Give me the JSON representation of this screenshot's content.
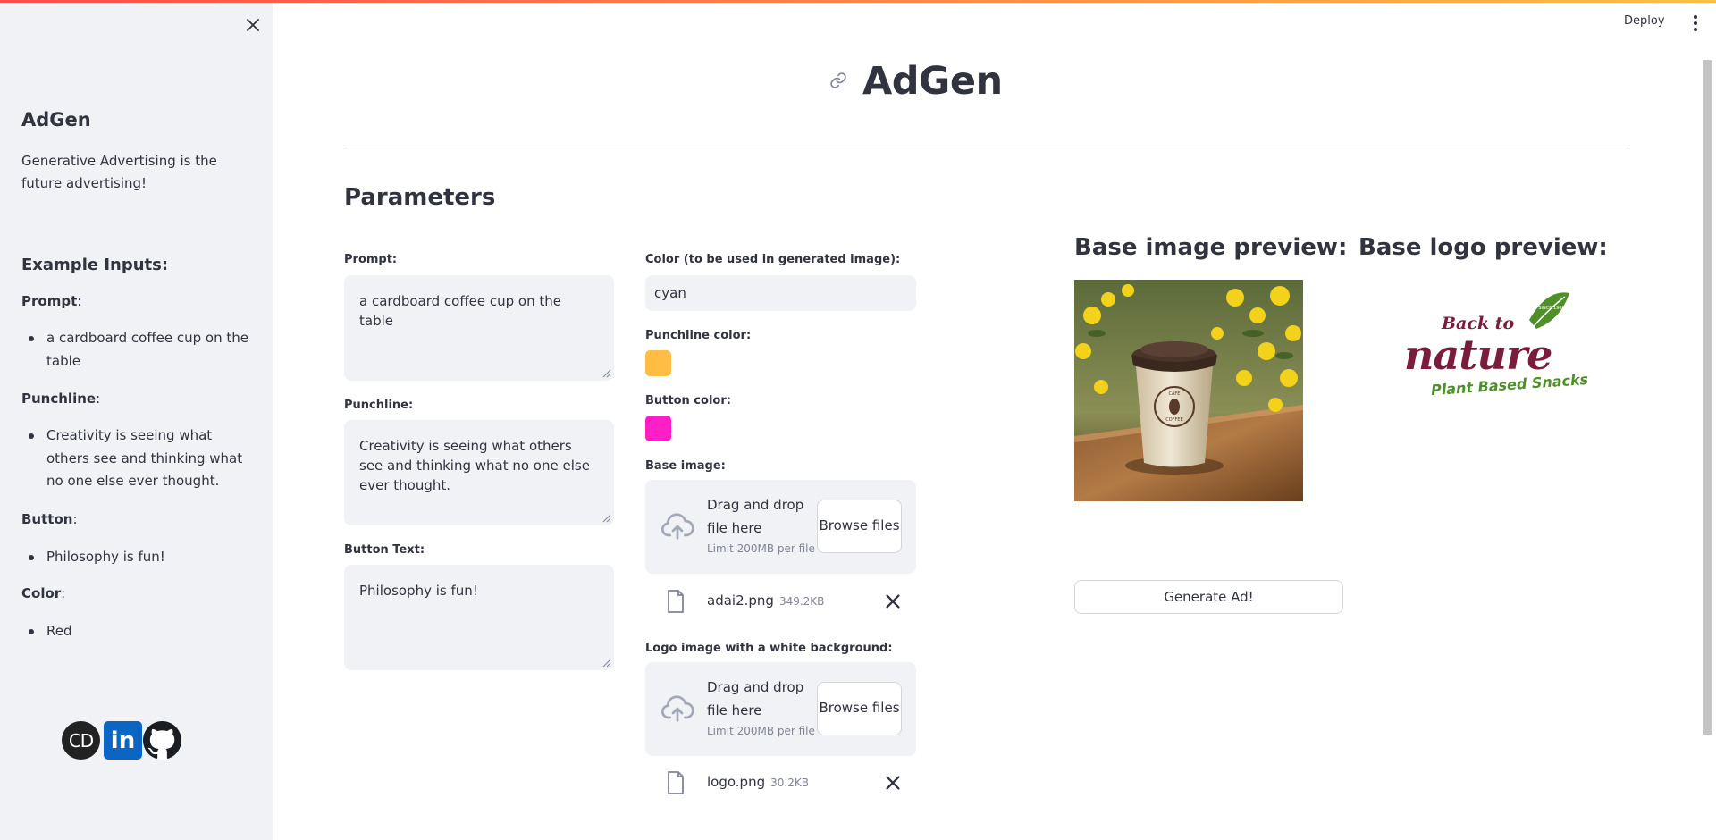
{
  "header": {
    "deploy_label": "Deploy"
  },
  "sidebar": {
    "title": "AdGen",
    "description": "Generative Advertising is the future advertising!",
    "examples_heading": "Example Inputs:",
    "prompt_label": "Prompt",
    "prompt_example": "a cardboard coffee cup on the table",
    "punchline_label": "Punchline",
    "punchline_example": "Creativity is seeing what others see and thinking what no one else ever thought.",
    "button_label": "Button",
    "button_example": "Philosophy is fun!",
    "color_label": "Color",
    "color_example": "Red",
    "social": {
      "cd": "CD",
      "linkedin": "in"
    }
  },
  "main": {
    "title": "AdGen",
    "section_title": "Parameters",
    "prompt": {
      "label": "Prompt:",
      "value": "a cardboard coffee cup on the table"
    },
    "punchline": {
      "label": "Punchline:",
      "value": "Creativity is seeing what others see and thinking what no one else ever thought."
    },
    "button_text": {
      "label": "Button Text:",
      "value": "Philosophy is fun!"
    },
    "color": {
      "label": "Color (to be used in generated image):",
      "value": "cyan"
    },
    "punchline_color": {
      "label": "Punchline color:",
      "value": "#ffbd45"
    },
    "button_color": {
      "label": "Button color:",
      "value": "#ff1fc7"
    },
    "base_image": {
      "label": "Base image:",
      "drop_text": "Drag and drop file here",
      "limit": "Limit 200MB per file",
      "browse": "Browse files",
      "file_name": "adai2.png",
      "file_size": "349.2KB"
    },
    "logo_image": {
      "label": "Logo image with a white background:",
      "drop_text": "Drag and drop file here",
      "limit": "Limit 200MB per file",
      "browse": "Browse files",
      "file_name": "logo.png",
      "file_size": "30.2KB"
    },
    "base_preview_title": "Base image preview:",
    "logo_preview_title": "Base logo preview:",
    "logo_text": {
      "line1": "Back to",
      "line2": "nature",
      "line3": "Plant Based Snacks",
      "badge": "SINCE 1960"
    },
    "cup_text": {
      "top": "CAFE",
      "bottom": "COFFEE"
    },
    "generate_label": "Generate Ad!"
  },
  "colors": {
    "accent": "#ff4b4b",
    "sidebar_bg": "#f0f2f6",
    "logo_maroon": "#7a1d3d",
    "logo_green": "#4f8f2a"
  }
}
